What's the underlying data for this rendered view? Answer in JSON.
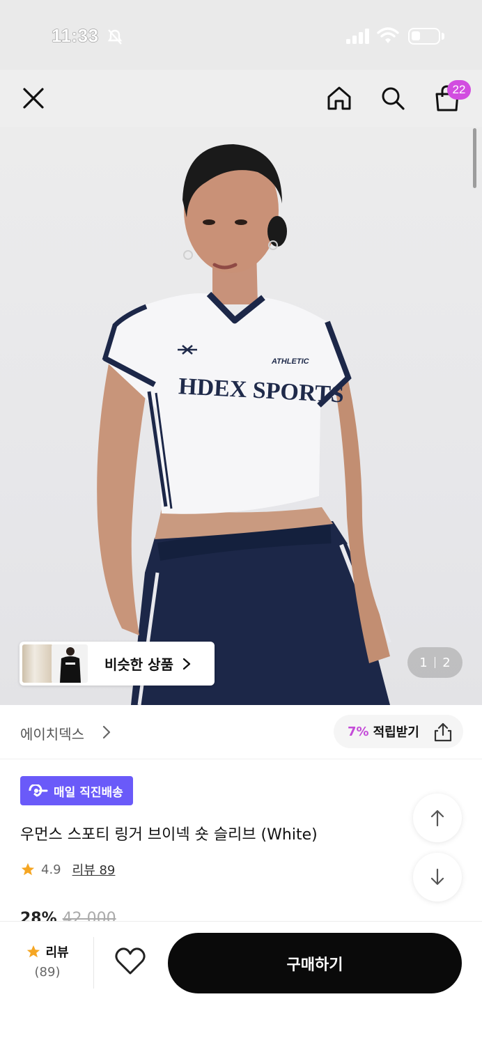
{
  "status_bar": {
    "time": "11:33"
  },
  "nav": {
    "cart_count": "22"
  },
  "hero": {
    "shirt_brand_text": "HDEX SPORTS",
    "shirt_tag_text": "ATHLETIC",
    "similar_label": "비슷한 상품",
    "page_current": "1",
    "page_total": "2"
  },
  "brand": {
    "name": "에이치덱스",
    "reward_pct": "7%",
    "reward_label": "적립받기"
  },
  "product": {
    "badge": "매일 직진배송",
    "title": "우먼스 스포티 링거 브이넥 숏 슬리브 (White)",
    "rating": "4.9",
    "review_label": "리뷰 89",
    "discount": "28%",
    "original_price": "42,000"
  },
  "bottom_bar": {
    "review_label": "리뷰",
    "review_count": "(89)",
    "buy_label": "구매하기"
  },
  "colors": {
    "accent_purple": "#6a5af9",
    "badge_pink": "#d24de0",
    "star": "#f5a623",
    "buy_button": "#0a0a0a"
  }
}
